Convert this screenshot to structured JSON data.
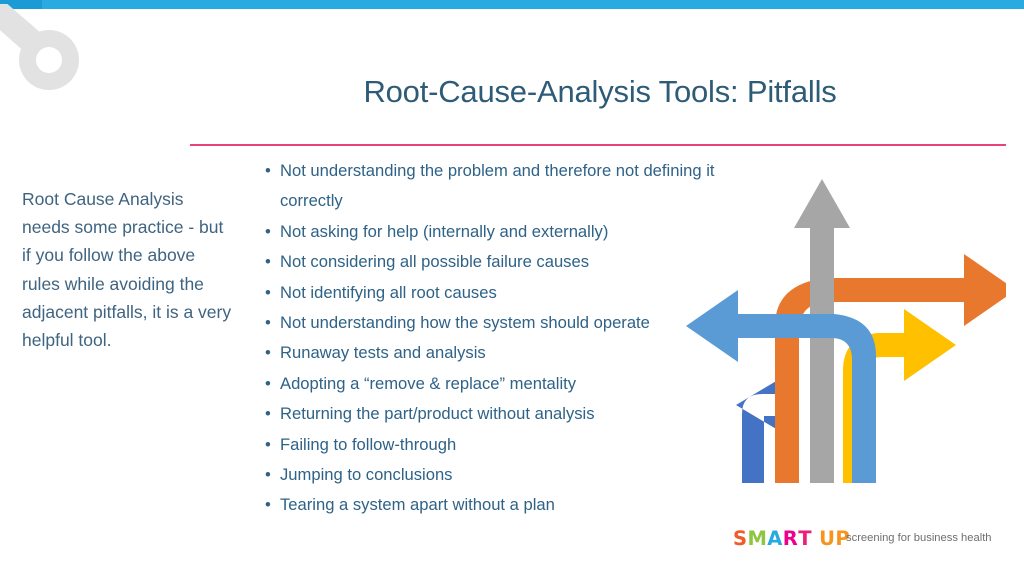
{
  "slide": {
    "title": "Root-Cause-Analysis Tools: Pitfalls",
    "side_note": "Root Cause Analysis needs some practice - but if you follow the above rules while avoiding the adjacent pitfalls, it is a very helpful tool.",
    "bullets": [
      "Not understanding the problem and therefore not defining it correctly",
      "Not asking for help (internally and externally)",
      "Not considering all possible failure causes",
      "Not identifying all root causes",
      "Not understanding how the system should operate",
      "Runaway tests and analysis",
      "Adopting a “remove & replace” mentality",
      "Returning the part/product without analysis",
      "Failing to follow-through",
      "Jumping to conclusions",
      "Tearing a system apart without a plan"
    ],
    "bullet_marker": "•"
  },
  "logo": {
    "letters": [
      {
        "char": "S",
        "color": "#F15A29"
      },
      {
        "char": "M",
        "color": "#8DC63F"
      },
      {
        "char": "A",
        "color": "#27AAE1"
      },
      {
        "char": "R",
        "color": "#EC008C"
      },
      {
        "char": "T",
        "color": "#EC1E79"
      },
      {
        "char": " ",
        "color": "#FFFFFF"
      },
      {
        "char": "U",
        "color": "#F7941E"
      },
      {
        "char": "P",
        "color": "#F7941E"
      }
    ],
    "tagline": "screening for business health"
  },
  "graphic": {
    "name": "five-paths-arrows",
    "arrows": [
      {
        "id": "arrow-dark-blue-left",
        "color": "#4472C4",
        "direction": "left"
      },
      {
        "id": "arrow-orange-right",
        "color": "#E8782E",
        "direction": "right"
      },
      {
        "id": "arrow-gray-up",
        "color": "#A6A6A6",
        "direction": "up"
      },
      {
        "id": "arrow-yellow-right",
        "color": "#FFC000",
        "direction": "right"
      },
      {
        "id": "arrow-light-blue-left",
        "color": "#5B9BD5",
        "direction": "left"
      }
    ]
  },
  "theme": {
    "accent_bar": "#29ABE2",
    "accent_bar_dark": "#1C9AD6",
    "divider": "#E8417E",
    "title_color": "#2E5C78",
    "body_color": "#2E6287",
    "side_note_color": "#3F6480",
    "watermark": "#E2E2E2"
  }
}
